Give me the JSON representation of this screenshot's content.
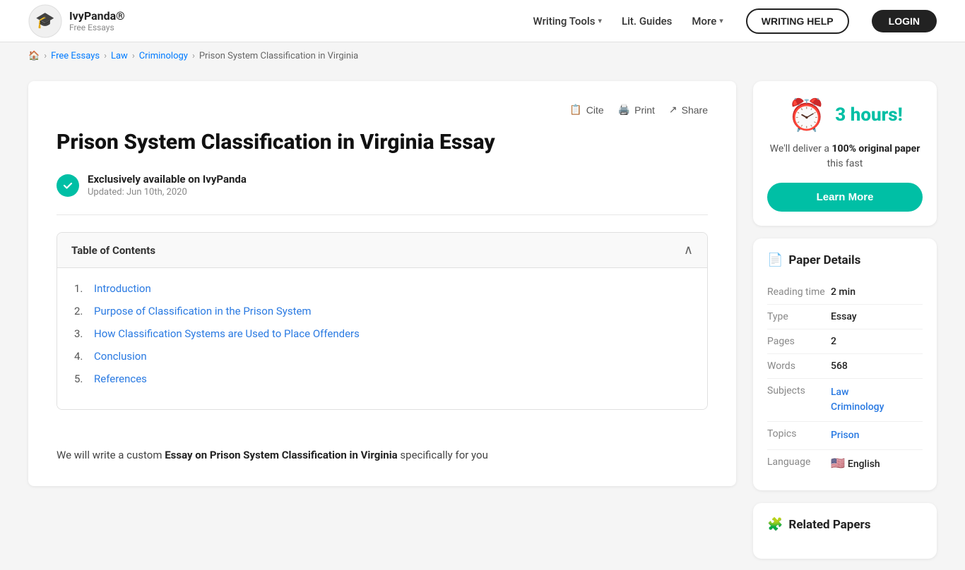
{
  "header": {
    "logo_name": "IvyPanda®",
    "logo_sub": "Free Essays",
    "nav": {
      "writing_tools": "Writing Tools",
      "lit_guides": "Lit. Guides",
      "more": "More",
      "writing_help": "WRITING HELP",
      "login": "LOGIN"
    }
  },
  "breadcrumb": {
    "home": "🏠",
    "items": [
      "Free Essays",
      "Law",
      "Criminology",
      "Prison System Classification in Virginia"
    ]
  },
  "article": {
    "title": "Prison System Classification in Virginia Essay",
    "actions": {
      "cite": "Cite",
      "print": "Print",
      "share": "Share"
    },
    "exclusive_label": "Exclusively available on IvyPanda",
    "updated": "Updated: Jun 10th, 2020",
    "toc_title": "Table of Contents",
    "toc_items": [
      {
        "num": "1.",
        "label": "Introduction",
        "href": "#"
      },
      {
        "num": "2.",
        "label": "Purpose of Classification in the Prison System",
        "href": "#"
      },
      {
        "num": "3.",
        "label": "How Classification Systems are Used to Place Offenders",
        "href": "#"
      },
      {
        "num": "4.",
        "label": "Conclusion",
        "href": "#"
      },
      {
        "num": "5.",
        "label": "References",
        "href": "#"
      }
    ],
    "custom_note": "We will write a custom ",
    "custom_note_bold": "Essay on Prison System Classification in Virginia",
    "custom_note_end": " specifically for you"
  },
  "promo": {
    "hours": "3 hours!",
    "clock_emoji": "⏰",
    "desc_prefix": "We'll deliver a ",
    "desc_bold": "100% original paper",
    "desc_suffix": " this fast",
    "learn_more": "Learn More"
  },
  "paper_details": {
    "heading": "Paper Details",
    "heading_icon": "📄",
    "rows": [
      {
        "label": "Reading time",
        "value": "2 min"
      },
      {
        "label": "Type",
        "value": "Essay"
      },
      {
        "label": "Pages",
        "value": "2"
      },
      {
        "label": "Words",
        "value": "568"
      },
      {
        "label": "Subjects",
        "links": [
          "Law",
          "Criminology"
        ]
      },
      {
        "label": "Topics",
        "links": [
          "Prison"
        ]
      },
      {
        "label": "Language",
        "flag": "🇺🇸",
        "value": "English"
      }
    ]
  },
  "related_papers": {
    "heading": "Related Papers",
    "heading_icon": "🧩"
  }
}
